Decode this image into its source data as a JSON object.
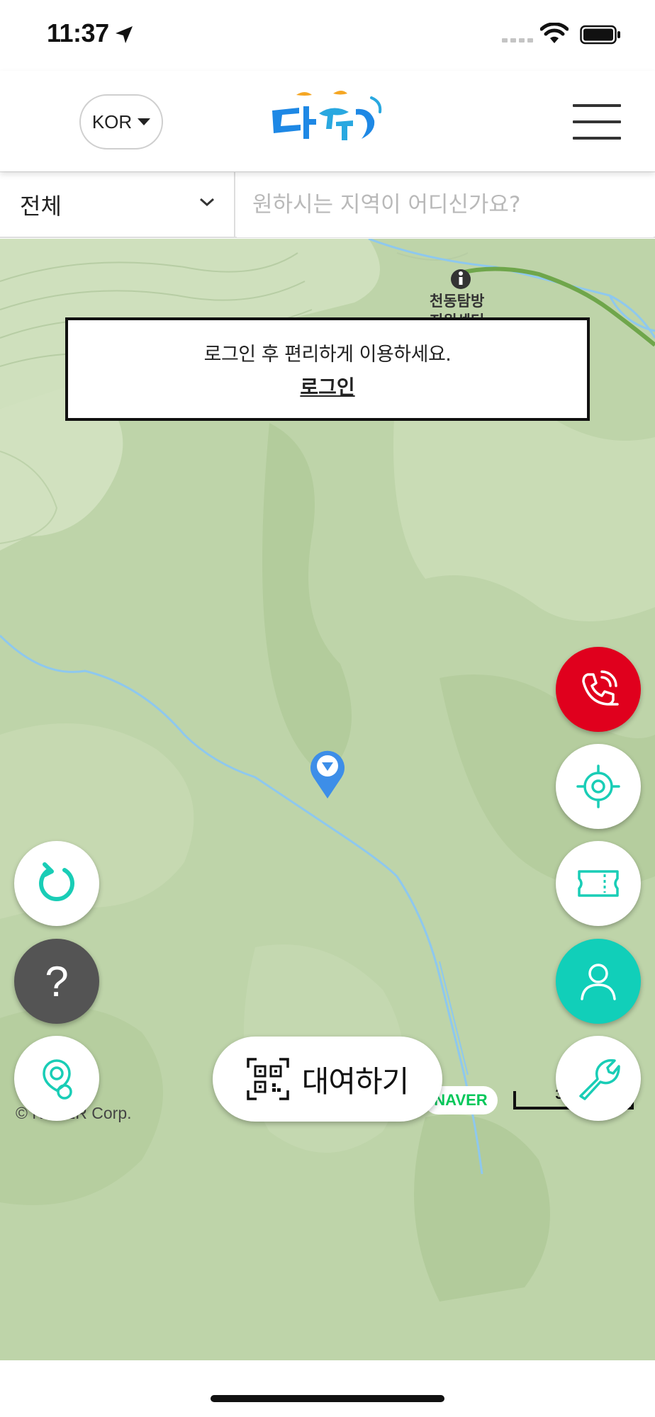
{
  "status_bar": {
    "time": "11:37"
  },
  "header": {
    "language_label": "KOR",
    "logo_icon": "tashu-logo",
    "menu_icon": "hamburger-menu-icon"
  },
  "search": {
    "region_selected": "전체",
    "placeholder": "원하시는 지역이 어디신가요?"
  },
  "map": {
    "poi_label_line1": "천동탐방",
    "poi_label_line2": "지원센터",
    "login_message": "로그인 후 편리하게 이용하세요.",
    "login_link": "로그인",
    "copyright": "© NAVER Corp.",
    "provider_logo": "NAVER",
    "scale": "300m"
  },
  "actions": {
    "rent_label": "대여하기",
    "help_label": "?"
  },
  "colors": {
    "call_button": "#e0001d",
    "user_button": "#11cfb9",
    "accent_teal": "#19cdb6",
    "help_button": "#545454",
    "map_base": "#bed4a9",
    "marker": "#3d8ee8",
    "trail": "#6fa64b",
    "stream": "#8ec8ee"
  }
}
